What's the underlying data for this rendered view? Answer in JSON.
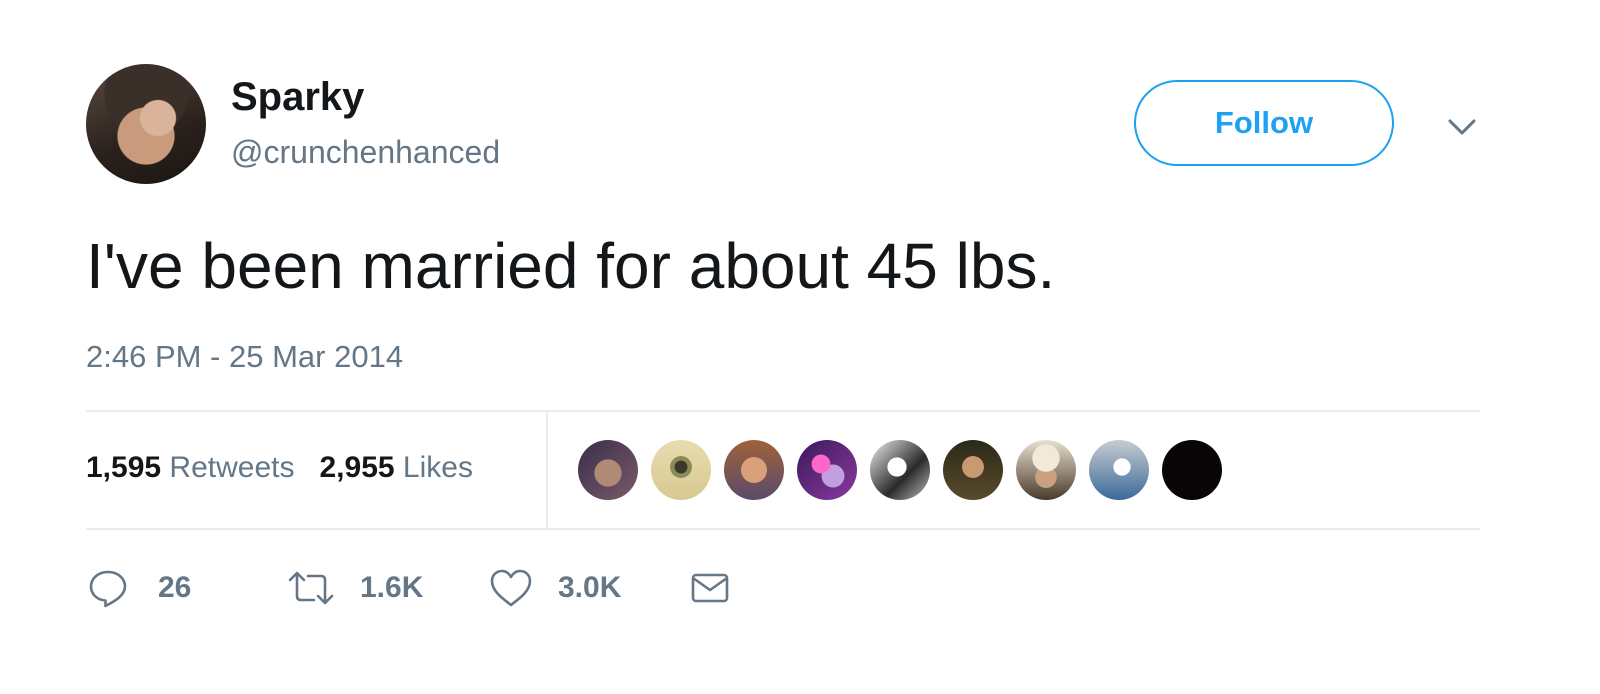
{
  "user": {
    "display_name": "Sparky",
    "handle": "@crunchenhanced"
  },
  "follow_button_label": "Follow",
  "tweet": {
    "text": "I've been married for about 45 lbs.",
    "timestamp": "2:46 PM - 25 Mar 2014"
  },
  "stats": {
    "retweets_count": "1,595",
    "retweets_label": "Retweets",
    "likes_count": "2,955",
    "likes_label": "Likes"
  },
  "actions": {
    "reply_count": "26",
    "retweet_count": "1.6K",
    "like_count": "3.0K"
  },
  "icons": {
    "caret": "chevron-down-icon",
    "reply": "reply-icon",
    "retweet": "retweet-icon",
    "like": "heart-icon",
    "dm": "envelope-icon"
  },
  "colors": {
    "accent": "#1da1f2",
    "text_primary": "#14171a",
    "text_secondary": "#657786",
    "divider": "#e6ecf0"
  }
}
